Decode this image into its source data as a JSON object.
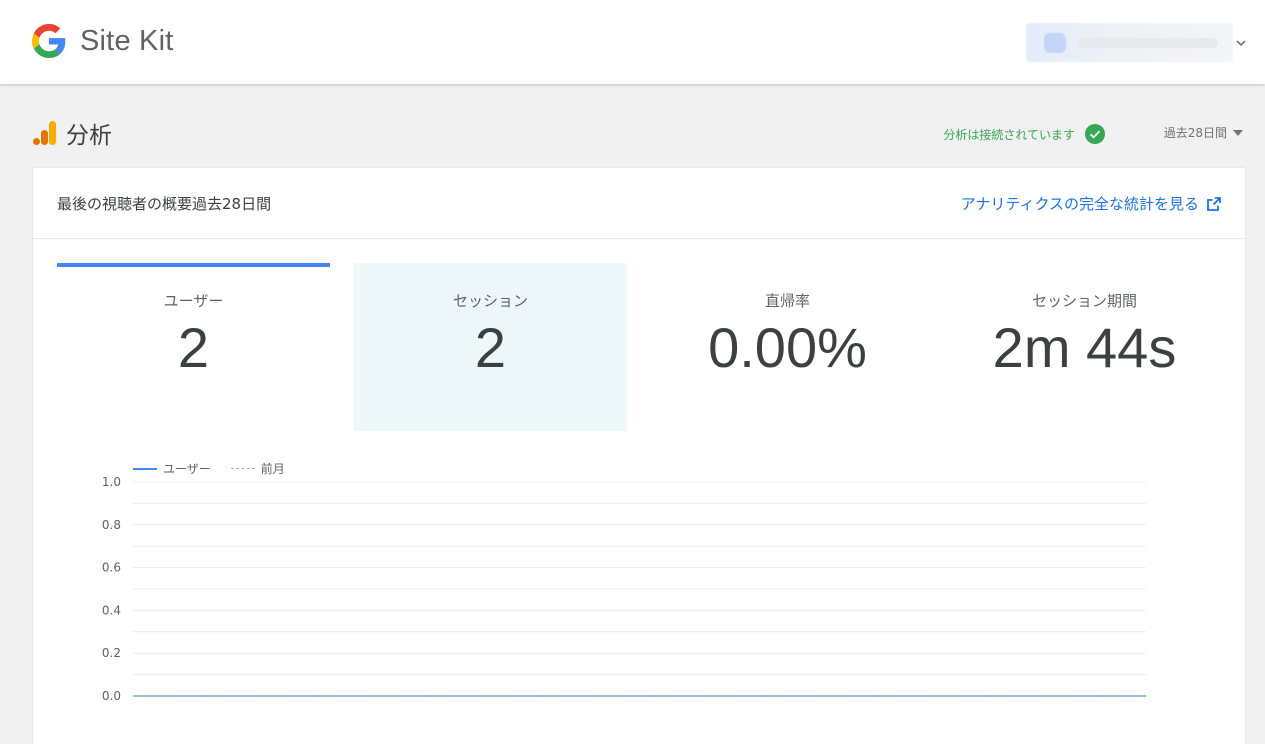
{
  "header": {
    "brand": "Site Kit"
  },
  "analytics": {
    "title": "分析",
    "connected_status": "分析は接続されています",
    "date_range": "過去28日間"
  },
  "card": {
    "title": "最後の視聴者の概要過去28日間",
    "full_stats_link": "アナリティクスの完全な統計を見る"
  },
  "metrics": [
    {
      "label": "ユーザー",
      "value": "2",
      "active": true
    },
    {
      "label": "セッション",
      "value": "2",
      "selected": true
    },
    {
      "label": "直帰率",
      "value": "0.00%"
    },
    {
      "label": "セッション期間",
      "value": "2m 44s"
    }
  ],
  "colors": {
    "accent": "#4285f4",
    "link": "#1a73e8",
    "success": "#34a853",
    "selected_tile": "#eef7fa"
  },
  "chart_data": {
    "type": "line",
    "series": [
      {
        "name": "ユーザー",
        "values": [
          0,
          0,
          0,
          0,
          0,
          0,
          0,
          0,
          0,
          0,
          0,
          0,
          0,
          0,
          0,
          0,
          0,
          0,
          0,
          0,
          0,
          0,
          0,
          0,
          0,
          0,
          0,
          0
        ],
        "color": "#4285f4",
        "style": "solid"
      },
      {
        "name": "前月",
        "values": [
          0,
          0,
          0,
          0,
          0,
          0,
          0,
          0,
          0,
          0,
          0,
          0,
          0,
          0,
          0,
          0,
          0,
          0,
          0,
          0,
          0,
          0,
          0,
          0,
          0,
          0,
          0,
          0
        ],
        "color": "#4285f4",
        "style": "dashed"
      }
    ],
    "y_ticks": [
      "1.0",
      "0.8",
      "0.6",
      "0.4",
      "0.2",
      "0.0"
    ],
    "ylim": [
      0,
      1
    ],
    "grid": true,
    "legend_position": "top-left"
  }
}
